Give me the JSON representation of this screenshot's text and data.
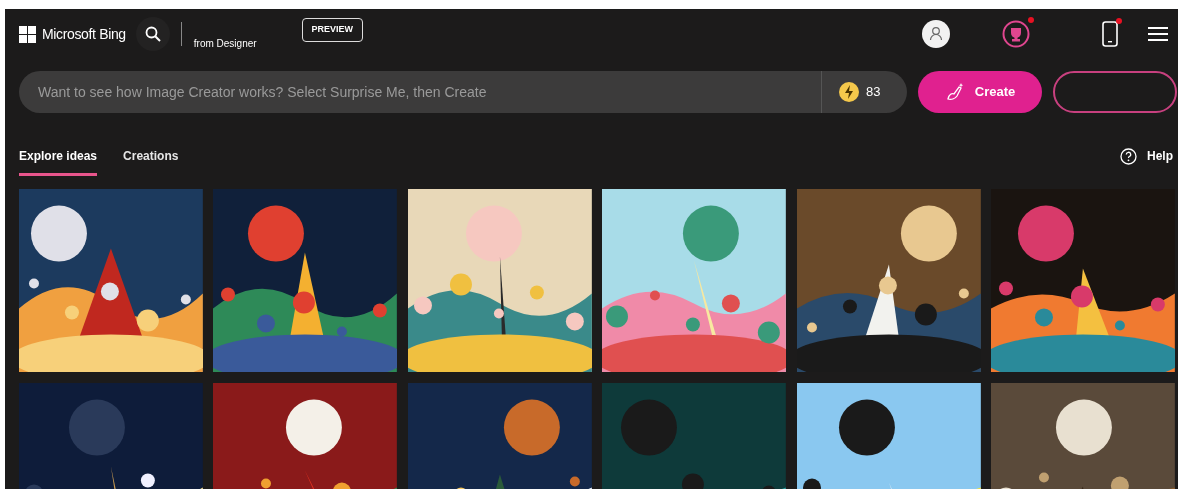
{
  "header": {
    "brand": "Microsoft Bing",
    "product": "from Designer",
    "badge": "PREVIEW",
    "icons": [
      {
        "kind": "avatar",
        "notification": false
      },
      {
        "kind": "rewards",
        "notification": true
      },
      {
        "kind": "phone",
        "notification": true
      },
      {
        "kind": "menu",
        "notification": false
      }
    ]
  },
  "prompt": {
    "placeholder": "Want to see how Image Creator works? Select Surprise Me, then Create",
    "boosts": "83"
  },
  "buttons": [
    {
      "kind": "create",
      "label": "Create"
    },
    {
      "kind": "outline"
    }
  ],
  "tabs": [
    {
      "label": "Explore ideas",
      "selected": true
    },
    {
      "label": "Creations",
      "selected": false
    }
  ],
  "help": "Help"
}
